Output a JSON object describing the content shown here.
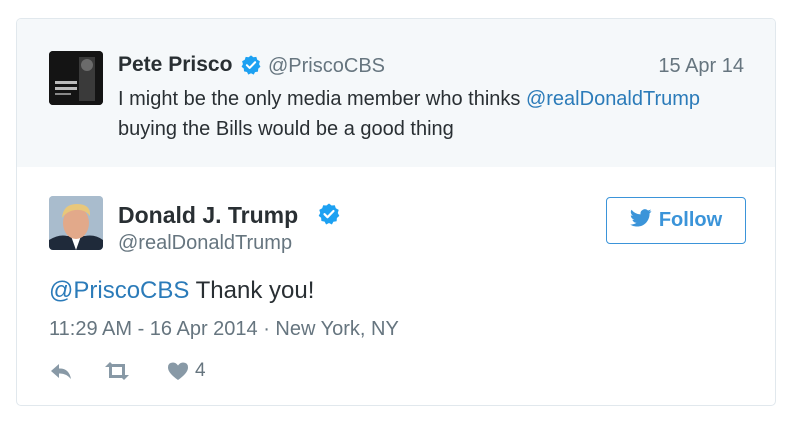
{
  "quoted_tweet": {
    "name": "Pete Prisco",
    "handle": "@PriscoCBS",
    "date": "15 Apr 14",
    "text_before": "I might be the only media member who thinks ",
    "mention": "@realDonaldTrump",
    "text_after": " buying the Bills would be a good thing"
  },
  "main_tweet": {
    "name": "Donald J. Trump",
    "handle": "@realDonaldTrump",
    "follow_label": "Follow",
    "mention": "@PriscoCBS",
    "text": " Thank you!",
    "meta": "11:29 AM - 16 Apr 2014 · New York, NY",
    "like_count": "4"
  },
  "colors": {
    "link": "#2b7bb9",
    "verified": "#1da1f2",
    "follow": "#3b94d9",
    "muted": "#66757f",
    "quoted_bg": "#f5f8fa"
  }
}
